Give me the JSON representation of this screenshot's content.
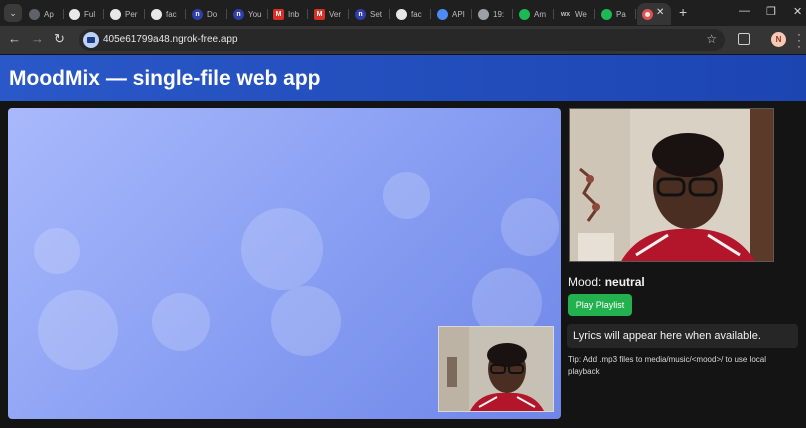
{
  "browser": {
    "tabs": [
      {
        "label": "Ap",
        "icon": "globe-icon",
        "color": "#9aa0a6"
      },
      {
        "label": "Ful",
        "icon": "github-icon",
        "color": "#e8e8e8"
      },
      {
        "label": "Per",
        "icon": "github-icon",
        "color": "#e8e8e8"
      },
      {
        "label": "fac",
        "icon": "github-icon",
        "color": "#e8e8e8"
      },
      {
        "label": "Do",
        "icon": "n-icon",
        "color": "#2f3ea8"
      },
      {
        "label": "You",
        "icon": "n-icon",
        "color": "#2f3ea8"
      },
      {
        "label": "Inb",
        "icon": "gmail-icon",
        "color": "#d93025"
      },
      {
        "label": "Ver",
        "icon": "gmail-icon",
        "color": "#d93025"
      },
      {
        "label": "Set",
        "icon": "n-icon",
        "color": "#2f3ea8"
      },
      {
        "label": "fac",
        "icon": "github-icon",
        "color": "#e8e8e8"
      },
      {
        "label": "API",
        "icon": "api-icon",
        "color": "#4c8bf5"
      },
      {
        "label": "19:",
        "icon": "globe-icon",
        "color": "#9aa0a6"
      },
      {
        "label": "Am",
        "icon": "spotify-icon",
        "color": "#1db954"
      },
      {
        "label": "We",
        "icon": "wix-icon",
        "color": "#9aa0a6"
      },
      {
        "label": "Pa",
        "icon": "spotify-icon",
        "color": "#1db954"
      }
    ],
    "active_tab_icon": "record-icon",
    "url": "405e61799a48.ngrok-free.app",
    "profile_initial": "N"
  },
  "app": {
    "title": "MoodMix — single-file web app",
    "mood_label": "Mood:",
    "mood_value": "neutral",
    "play_button": "Play Playlist",
    "lyrics_placeholder": "Lyrics will appear here when available.",
    "tip": "Tip: Add .mp3 files to media/music/<mood>/ to use local playback"
  },
  "colors": {
    "header": "#2152c0",
    "play_button": "#23b14f",
    "stage_gradient_start": "#a9b9fb",
    "stage_gradient_end": "#6f86e8"
  }
}
